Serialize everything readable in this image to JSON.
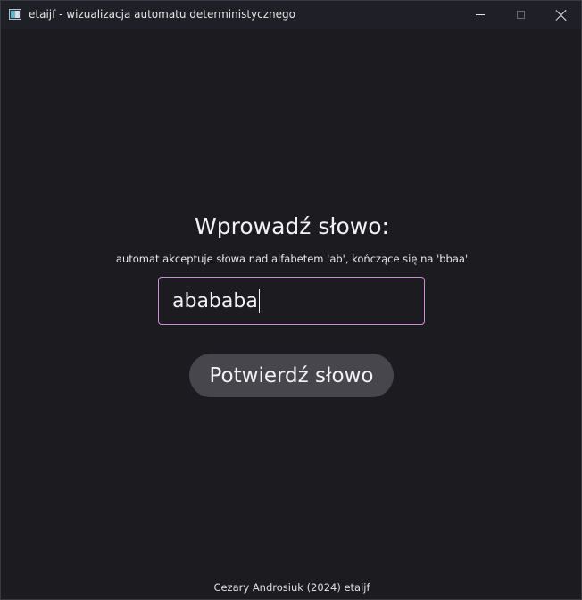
{
  "window": {
    "title": "etaijf - wizualizacja automatu deterministycznego",
    "icon": "app-window-icon",
    "controls": {
      "minimize_icon": "minimize-icon",
      "maximize_icon": "maximize-icon",
      "close_icon": "close-icon"
    }
  },
  "main": {
    "heading": "Wprowadź słowo:",
    "subtitle": "automat akceptuje słowa nad alfabetem 'ab', kończące się na 'bbaa'",
    "input": {
      "value": "abababa"
    },
    "confirm_button": "Potwierdź słowo"
  },
  "footer": {
    "text": "Cezary Androsiuk (2024) etaijf"
  },
  "colors": {
    "background": "#1c1b1f",
    "titlebar": "#1f1f28",
    "input_border": "#c98fcf",
    "button_bg": "#47464c",
    "text": "#f2f2f2"
  }
}
